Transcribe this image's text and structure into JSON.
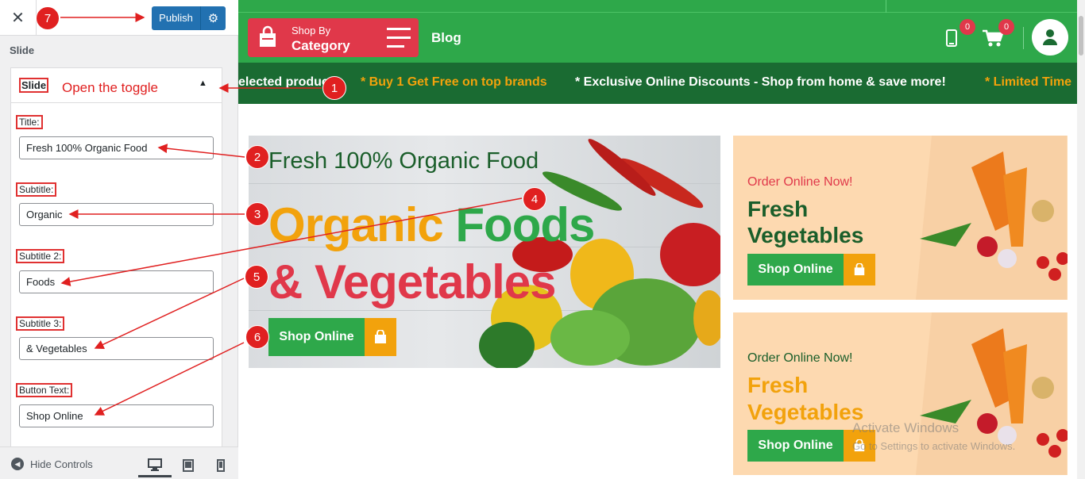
{
  "sidebar": {
    "close_glyph": "✕",
    "publish_label": "Publish",
    "section_title": "Slide",
    "panel_title": "Slide",
    "toggle_glyph": "▲",
    "fields": [
      {
        "label": "Title:",
        "value": "Fresh 100% Organic Food"
      },
      {
        "label": "Subtitle:",
        "value": "Organic"
      },
      {
        "label": "Subtitle 2:",
        "value": "Foods"
      },
      {
        "label": "Subtitle 3:",
        "value": "& Vegetables"
      },
      {
        "label": "Button Text:",
        "value": "Shop Online"
      }
    ],
    "hide_controls": "Hide Controls"
  },
  "header": {
    "shop_by": "Shop By",
    "category": "Category",
    "blog": "Blog",
    "wishlist_count": "0",
    "cart_count": "0"
  },
  "ticker": {
    "items": [
      {
        "text": "elected products",
        "color": "#ffffff"
      },
      {
        "text": "*  Buy 1 Get Free on top brands",
        "color": "#f2a20c"
      },
      {
        "text": "*  Exclusive Online Discounts - Shop from home & save more!",
        "color": "#ffffff"
      },
      {
        "text": "*  Limited Time",
        "color": "#f2a20c"
      }
    ]
  },
  "hero": {
    "title": "Fresh 100% Organic Food",
    "subtitle": "Organic",
    "subtitle2": "Foods",
    "subtitle3": "& Vegetables",
    "button": "Shop Online"
  },
  "promos": [
    {
      "pre": "Order Online Now!",
      "line1": "Fresh",
      "line2": "Vegetables",
      "button": "Shop Online",
      "pre_color": "#e0384a",
      "title_color": "#1a5e2a"
    },
    {
      "pre": "Order Online Now!",
      "line1": "Fresh",
      "line2": "Vegetables",
      "button": "Shop Online",
      "pre_color": "#1a5e2a",
      "title_color": "#f2a20c"
    }
  ],
  "annotations": {
    "open_toggle": "Open the toggle",
    "n1": "1",
    "n2": "2",
    "n3": "3",
    "n4": "4",
    "n5": "5",
    "n6": "6",
    "n7": "7"
  },
  "watermark": {
    "line1": "Activate Windows",
    "line2": "Go to Settings to activate Windows."
  },
  "colors": {
    "green": "#2ea84a",
    "dark_green": "#1a6b32",
    "red": "#e0384a",
    "orange": "#f2a20c",
    "wp_blue": "#2271b1"
  }
}
